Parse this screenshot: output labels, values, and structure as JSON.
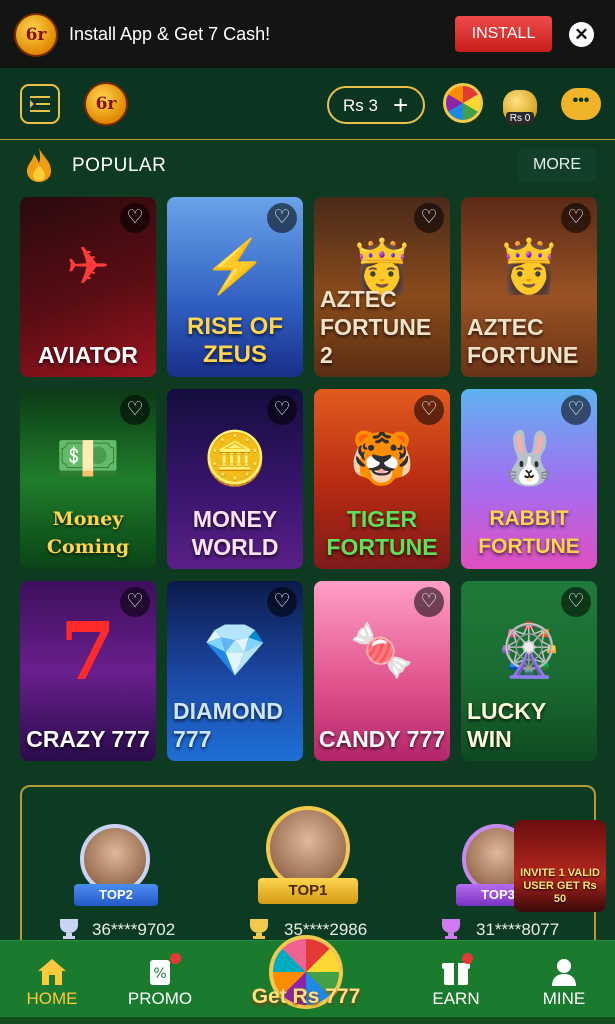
{
  "banner": {
    "logo_text": "6r",
    "title": "Install App & Get 7 Cash!",
    "install_label": "INSTALL",
    "close_glyph": "✕"
  },
  "header": {
    "brand_text": "6r",
    "balance": "Rs 3",
    "plus_glyph": "+",
    "bag_label": "Rs 0",
    "icons": [
      "menu-icon",
      "spin-wheel-icon",
      "money-bag-icon",
      "support-chat-icon"
    ]
  },
  "popular": {
    "title": "POPULAR",
    "more_label": "MORE",
    "games": [
      {
        "name": "AVIATOR",
        "art": "✈"
      },
      {
        "name": "RISE OF ZEUS",
        "art": "⚡"
      },
      {
        "name": "AZTEC FORTUNE 2",
        "art": "👸"
      },
      {
        "name": "AZTEC FORTUNE",
        "art": "👸"
      },
      {
        "name": "Money Coming",
        "art": "💵"
      },
      {
        "name": "MONEY WORLD",
        "art": "🪙"
      },
      {
        "name": "TIGER FORTUNE",
        "art": "🐯"
      },
      {
        "name": "RABBIT FORTUNE",
        "art": "🐰"
      },
      {
        "name": "CRAZY 777",
        "art": "7"
      },
      {
        "name": "DIAMOND 777",
        "art": "💎"
      },
      {
        "name": "CANDY 777",
        "art": "🍬"
      },
      {
        "name": "LUCKY WIN",
        "art": "🎡"
      }
    ],
    "heart_glyph": "♡"
  },
  "leaderboard": {
    "ranks": [
      {
        "label": "TOP2",
        "score": "36****9702"
      },
      {
        "label": "TOP1",
        "score": "35****2986"
      },
      {
        "label": "TOP3",
        "score": "31****8077"
      }
    ],
    "promo_text": "INVITE 1 VALID USER GET Rs 50"
  },
  "nav": {
    "items": [
      {
        "label": "HOME",
        "icon": "home-icon"
      },
      {
        "label": "PROMO",
        "icon": "promo-icon"
      },
      {
        "label": "EARN",
        "icon": "gift-icon"
      },
      {
        "label": "MINE",
        "icon": "user-icon"
      }
    ],
    "spin_label": "Get Rs 777"
  },
  "colors": {
    "background": "#0e3a21",
    "accent_gold": "#e6c24a",
    "install_red": "#e53935",
    "nav_green": "#1a7a2e",
    "active_nav": "#ffc93c"
  }
}
